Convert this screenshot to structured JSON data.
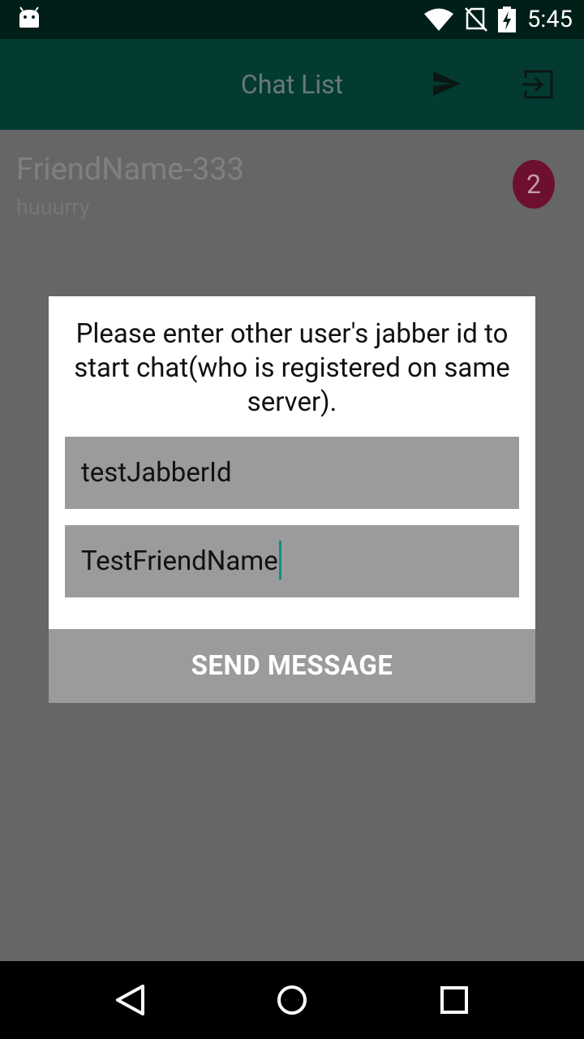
{
  "status_bar": {
    "time": "5:45",
    "icons": [
      "android-icon",
      "wifi-icon",
      "no-sim-icon",
      "battery-charging-icon"
    ]
  },
  "app_bar": {
    "title": "Chat List",
    "icons": [
      "send-icon",
      "exit-icon"
    ]
  },
  "chat_list": {
    "items": [
      {
        "name": "FriendName-333",
        "preview": "huuurry",
        "unread_count": "2"
      }
    ]
  },
  "dialog": {
    "message": "Please enter other user's jabber id to start chat(who is registered on same server).",
    "jabber_id_value": "testJabberId",
    "friend_name_value": "TestFriendName",
    "send_button_label": "SEND MESSAGE"
  },
  "nav_bar": {
    "icons": [
      "back-icon",
      "home-icon",
      "recents-icon"
    ]
  },
  "colors": {
    "app_bar": "#033b32",
    "status_bar": "#001f18",
    "badge": "#6d0f31",
    "cursor": "#0f8f81",
    "overlay": "#666666",
    "field": "#9a9b9c"
  }
}
